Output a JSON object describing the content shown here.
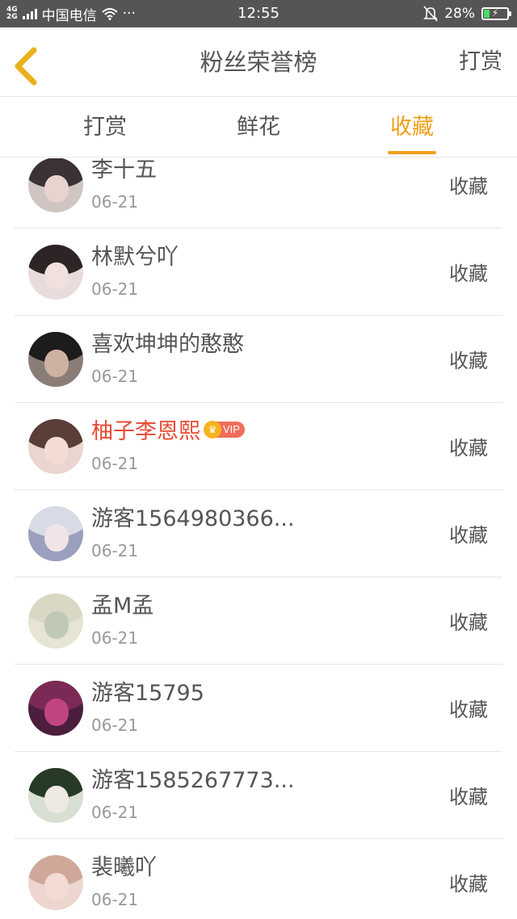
{
  "status_bar": {
    "network_top": "4G",
    "network_bottom": "2G",
    "carrier": "中国电信",
    "more": "···",
    "time": "12:55",
    "battery": "28%",
    "battery_level": 0.28
  },
  "nav": {
    "title": "粉丝荣誉榜",
    "action": "打赏"
  },
  "tabs": [
    {
      "label": "打赏"
    },
    {
      "label": "鲜花"
    },
    {
      "label": "收藏"
    }
  ],
  "active_tab": 2,
  "vip_label": "VIP",
  "colors": {
    "accent": "#f0a01a",
    "vip_name": "#e84a33"
  },
  "fans": [
    {
      "name": "李十五",
      "date": "06-21",
      "action": "收藏",
      "vip": false,
      "hair": "#3a3235",
      "skin": "#e9d3cf",
      "bg": "#cfc5c3"
    },
    {
      "name": "林默兮吖",
      "date": "06-21",
      "action": "收藏",
      "vip": false,
      "hair": "#2d2426",
      "skin": "#f1e0dc",
      "bg": "#e9dcdc"
    },
    {
      "name": "喜欢坤坤的憨憨",
      "date": "06-21",
      "action": "收藏",
      "vip": false,
      "hair": "#1e1b1b",
      "skin": "#cdb2a3",
      "bg": "#8a7d78"
    },
    {
      "name": "柚子李恩熙",
      "date": "06-21",
      "action": "收藏",
      "vip": true,
      "hair": "#5a3e38",
      "skin": "#f3dcd4",
      "bg": "#ead5d0"
    },
    {
      "name": "游客1564980366...",
      "date": "06-21",
      "action": "收藏",
      "vip": false,
      "hair": "#d8dbe6",
      "skin": "#f0e4e6",
      "bg": "#9aa0bd"
    },
    {
      "name": "孟M孟",
      "date": "06-21",
      "action": "收藏",
      "vip": false,
      "hair": "#d9d8c4",
      "skin": "#bfc9b6",
      "bg": "#e6e4d2"
    },
    {
      "name": "游客15795",
      "date": "06-21",
      "action": "收藏",
      "vip": false,
      "hair": "#7a2a55",
      "skin": "#c0447e",
      "bg": "#4a1e3c"
    },
    {
      "name": "游客1585267773...",
      "date": "06-21",
      "action": "收藏",
      "vip": false,
      "hair": "#263a26",
      "skin": "#efe9e4",
      "bg": "#d7e0d3"
    },
    {
      "name": "裴曦吖",
      "date": "06-21",
      "action": "收藏",
      "vip": false,
      "hair": "#cfa89a",
      "skin": "#f2dcd4",
      "bg": "#ecd6cf"
    }
  ]
}
